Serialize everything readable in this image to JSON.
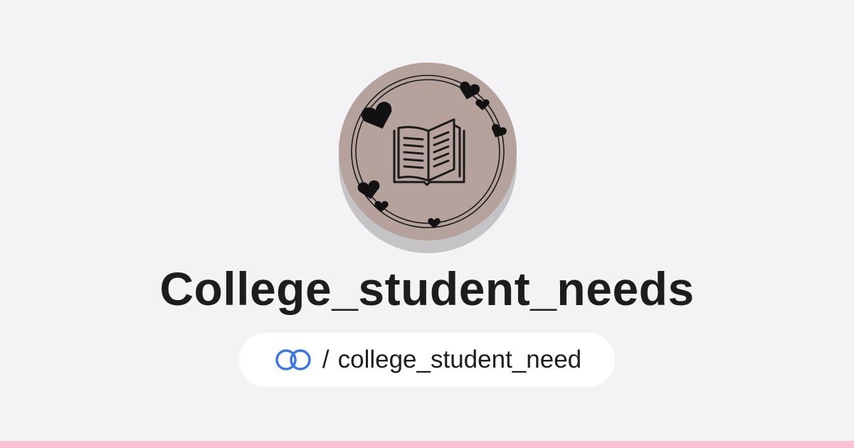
{
  "profile": {
    "display_name": "College_student_needs",
    "avatar_icon": "open-book-icon",
    "avatar_color": "#b5a29d"
  },
  "link": {
    "icon": "linked-rings-icon",
    "icon_color": "#3a76e8",
    "separator": "/",
    "handle": "college_student_need"
  },
  "theme": {
    "background": "#f3f3f6",
    "accent_bar": "#f8c3d3"
  }
}
